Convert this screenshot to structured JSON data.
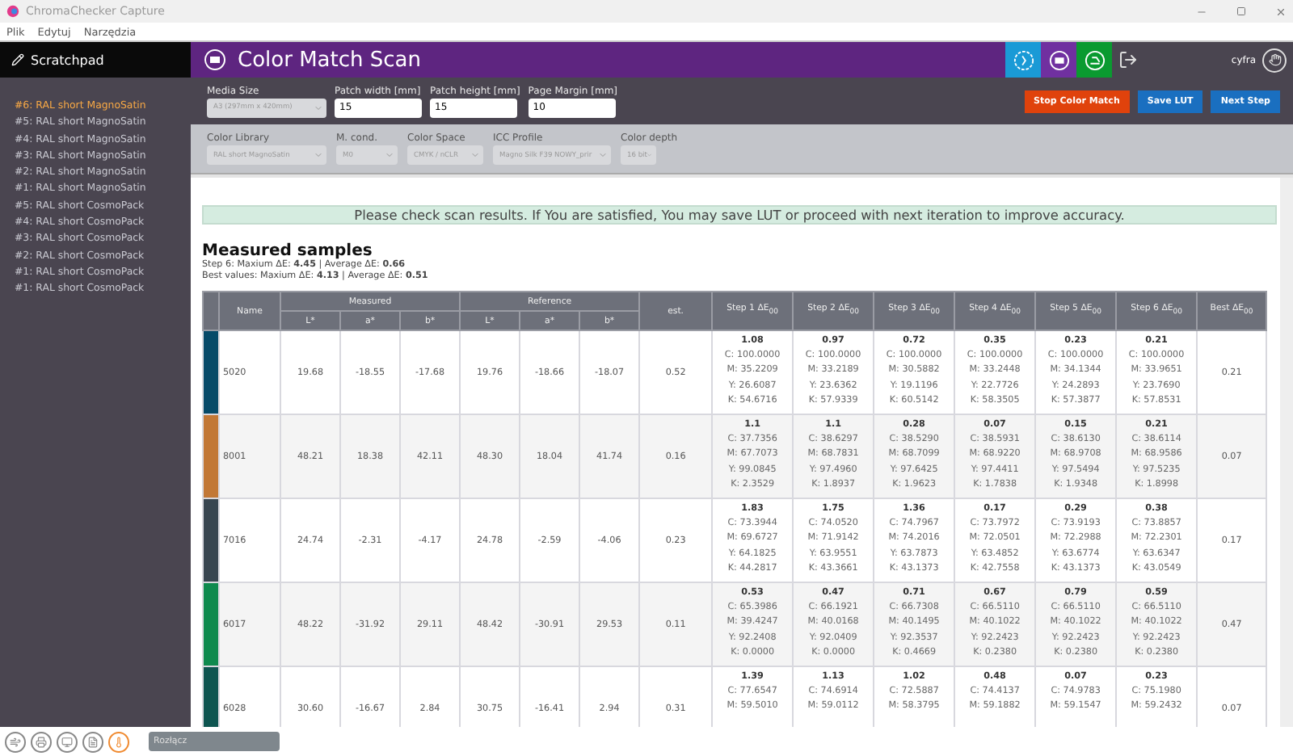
{
  "window": {
    "title": "ChromaChecker Capture"
  },
  "menu": [
    "Plik",
    "Edytuj",
    "Narzędzia"
  ],
  "sidebar": {
    "title": "Scratchpad",
    "items": [
      {
        "label": "#6: RAL short MagnoSatin",
        "selected": true
      },
      {
        "label": "#5: RAL short MagnoSatin",
        "selected": false
      },
      {
        "label": "#4: RAL short MagnoSatin",
        "selected": false
      },
      {
        "label": "#3: RAL short MagnoSatin",
        "selected": false
      },
      {
        "label": "#2: RAL short MagnoSatin",
        "selected": false
      },
      {
        "label": "#1: RAL short MagnoSatin",
        "selected": false
      },
      {
        "label": "#5: RAL short CosmoPack",
        "selected": false
      },
      {
        "label": "#4: RAL short CosmoPack",
        "selected": false
      },
      {
        "label": "#3: RAL short CosmoPack",
        "selected": false
      },
      {
        "label": "#2: RAL short CosmoPack",
        "selected": false
      },
      {
        "label": "#1: RAL short CosmoPack",
        "selected": false
      },
      {
        "label": "#1: RAL short CosmoPack",
        "selected": false
      }
    ]
  },
  "header": {
    "title": "Color Match Scan",
    "user": "cyfra"
  },
  "settings": [
    {
      "kind": "select",
      "label": "Media Size",
      "value": "A3 (297mm x 420mm)",
      "disabled": true
    },
    {
      "kind": "input",
      "label": "Patch width [mm]",
      "value": "15"
    },
    {
      "kind": "input",
      "label": "Patch height [mm]",
      "value": "15"
    },
    {
      "kind": "input",
      "label": "Page Margin [mm]",
      "value": "10"
    }
  ],
  "buttons": [
    {
      "label": "Stop Color Match",
      "kind": "danger"
    },
    {
      "label": "Save LUT",
      "kind": "primary"
    },
    {
      "label": "Next Step",
      "kind": "primary"
    }
  ],
  "options": [
    {
      "label": "Color Library",
      "value": "RAL short MagnoSatin",
      "disabled": true
    },
    {
      "label": "M. cond.",
      "value": "M0",
      "disabled": true
    },
    {
      "label": "Color Space",
      "value": "CMYK / nCLR",
      "disabled": true
    },
    {
      "label": "ICC Profile",
      "value": "Magno Silk F39 NOWY_prir",
      "disabled": true
    },
    {
      "label": "Color depth",
      "value": "16 bit",
      "disabled": true
    }
  ],
  "message": "Please check scan results. If You are satisfied, You may save LUT or proceed with next iteration to improve accuracy.",
  "samples": {
    "title": "Measured samples",
    "stats": [
      "Step 6: Maxium ΔE: **4.45** | Average ΔE: **0.66**",
      "Best values: Maxium ΔE: **4.13** | Average ΔE: **0.51**"
    ],
    "groups": [
      "Measured",
      "Reference"
    ],
    "columns": {
      "name": "Name",
      "lab": [
        "L*",
        "a*",
        "b*",
        "L*",
        "a*",
        "b*"
      ],
      "est": "est.",
      "steps": [
        "Step 1 ΔE$_{00}$",
        "Step 2 ΔE$_{00}$",
        "Step 3 ΔE$_{00}$",
        "Step 4 ΔE$_{00}$",
        "Step 5 ΔE$_{00}$",
        "Step 6 ΔE$_{00}$"
      ],
      "best": "Best ΔE$_{00}$"
    },
    "rows": [
      {
        "color": "#064a68",
        "name": "5020",
        "lab": [
          "19.68",
          "-18.55",
          "-17.68",
          "19.76",
          "-18.66",
          "-18.07"
        ],
        "est": "0.52",
        "best": "0.21",
        "steps": [
          [
            "1.08",
            "C: 100.0000",
            "M: 35.2209",
            "Y: 26.6087",
            "K: 54.6716"
          ],
          [
            "0.97",
            "C: 100.0000",
            "M: 33.2189",
            "Y: 23.6362",
            "K: 57.9339"
          ],
          [
            "0.72",
            "C: 100.0000",
            "M: 30.5882",
            "Y: 19.1196",
            "K: 60.5142"
          ],
          [
            "0.35",
            "C: 100.0000",
            "M: 33.2448",
            "Y: 22.7726",
            "K: 58.3505"
          ],
          [
            "0.23",
            "C: 100.0000",
            "M: 34.1344",
            "Y: 24.2893",
            "K: 57.3877"
          ],
          [
            "0.21",
            "C: 100.0000",
            "M: 33.9651",
            "Y: 23.7690",
            "K: 57.8531"
          ]
        ]
      },
      {
        "color": "#c27836",
        "name": "8001",
        "lab": [
          "48.21",
          "18.38",
          "42.11",
          "48.30",
          "18.04",
          "41.74"
        ],
        "est": "0.16",
        "best": "0.07",
        "steps": [
          [
            "1.1",
            "C: 37.7356",
            "M: 67.7073",
            "Y: 99.0845",
            "K: 2.3529"
          ],
          [
            "1.1",
            "C: 38.6297",
            "M: 68.7831",
            "Y: 97.4960",
            "K: 1.8937"
          ],
          [
            "0.28",
            "C: 38.5290",
            "M: 68.7099",
            "Y: 97.6425",
            "K: 1.9623"
          ],
          [
            "0.07",
            "C: 38.5931",
            "M: 68.9220",
            "Y: 97.4411",
            "K: 1.7838"
          ],
          [
            "0.15",
            "C: 38.6130",
            "M: 68.9708",
            "Y: 97.5494",
            "K: 1.9348"
          ],
          [
            "0.21",
            "C: 38.6114",
            "M: 68.9586",
            "Y: 97.5235",
            "K: 1.8998"
          ]
        ]
      },
      {
        "color": "#384650",
        "name": "7016",
        "lab": [
          "24.74",
          "-2.31",
          "-4.17",
          "24.78",
          "-2.59",
          "-4.06"
        ],
        "est": "0.23",
        "best": "0.17",
        "steps": [
          [
            "1.83",
            "C: 73.3944",
            "M: 69.6727",
            "Y: 64.1825",
            "K: 44.2817"
          ],
          [
            "1.75",
            "C: 74.0520",
            "M: 71.9142",
            "Y: 63.9551",
            "K: 43.3661"
          ],
          [
            "1.36",
            "C: 74.7967",
            "M: 74.2016",
            "Y: 63.7873",
            "K: 43.1373"
          ],
          [
            "0.17",
            "C: 73.7972",
            "M: 72.0501",
            "Y: 63.4852",
            "K: 42.7558"
          ],
          [
            "0.29",
            "C: 73.9193",
            "M: 72.2988",
            "Y: 63.6774",
            "K: 43.1373"
          ],
          [
            "0.38",
            "C: 73.8857",
            "M: 72.2301",
            "Y: 63.6347",
            "K: 43.0549"
          ]
        ]
      },
      {
        "color": "#0e8a4e",
        "name": "6017",
        "lab": [
          "48.22",
          "-31.92",
          "29.11",
          "48.42",
          "-30.91",
          "29.53"
        ],
        "est": "0.11",
        "best": "0.47",
        "steps": [
          [
            "0.53",
            "C: 65.3986",
            "M: 39.4247",
            "Y: 92.2408",
            "K: 0.0000"
          ],
          [
            "0.47",
            "C: 66.1921",
            "M: 40.0168",
            "Y: 92.0409",
            "K: 0.0000"
          ],
          [
            "0.71",
            "C: 66.7308",
            "M: 40.1495",
            "Y: 92.3537",
            "K: 0.4669"
          ],
          [
            "0.67",
            "C: 66.5110",
            "M: 40.1022",
            "Y: 92.2423",
            "K: 0.2380"
          ],
          [
            "0.79",
            "C: 66.5110",
            "M: 40.1022",
            "Y: 92.2423",
            "K: 0.2380"
          ],
          [
            "0.59",
            "C: 66.5110",
            "M: 40.1022",
            "Y: 92.2423",
            "K: 0.2380"
          ]
        ]
      },
      {
        "color": "#0e5550",
        "name": "6028",
        "lab": [
          "30.60",
          "-16.67",
          "2.84",
          "30.75",
          "-16.41",
          "2.94"
        ],
        "est": "0.31",
        "best": "0.07",
        "steps": [
          [
            "1.39",
            "C: 77.6547",
            "M: 59.5010"
          ],
          [
            "1.13",
            "C: 74.6914",
            "M: 59.0112"
          ],
          [
            "1.02",
            "C: 72.5887",
            "M: 58.3795"
          ],
          [
            "0.48",
            "C: 74.4137",
            "M: 59.1882"
          ],
          [
            "0.07",
            "C: 74.9783",
            "M: 59.1547"
          ],
          [
            "0.23",
            "C: 75.1980",
            "M: 59.2432"
          ]
        ]
      }
    ]
  },
  "footer": {
    "button": "Rozłącz"
  }
}
